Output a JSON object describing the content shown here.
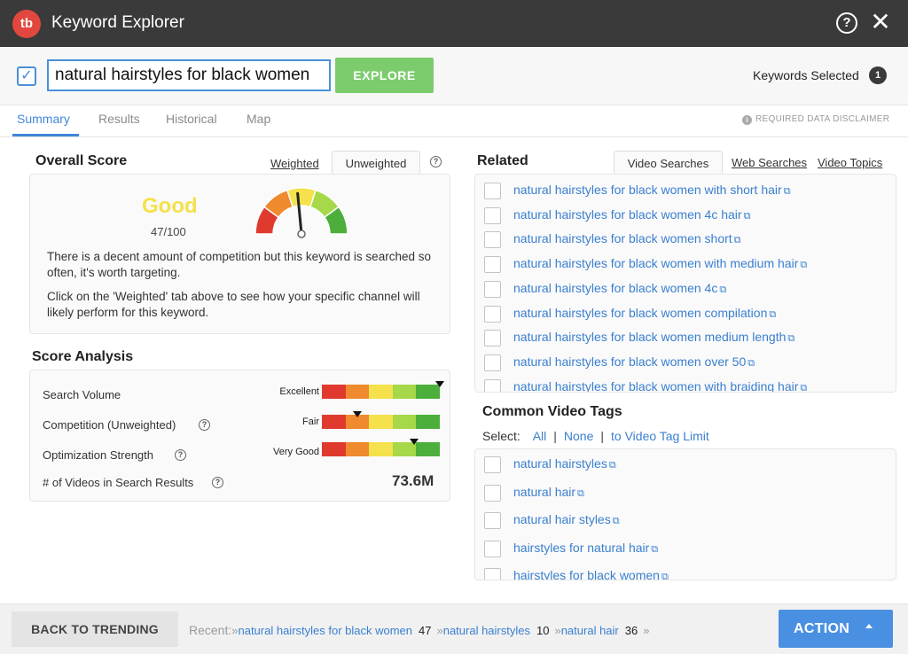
{
  "app": {
    "title": "Keyword Explorer",
    "logo_text": "tb"
  },
  "search": {
    "value": "natural hairstyles for black women",
    "explore_label": "EXPLORE",
    "keywords_selected_label": "Keywords Selected",
    "keywords_selected_count": "1"
  },
  "tabs": [
    {
      "label": "Summary",
      "active": true
    },
    {
      "label": "Results",
      "active": false
    },
    {
      "label": "Historical",
      "active": false
    },
    {
      "label": "Map",
      "active": false
    }
  ],
  "disclaimer": "REQUIRED DATA DISCLAIMER",
  "overall": {
    "heading": "Overall Score",
    "tab_weighted": "Weighted",
    "tab_unweighted": "Unweighted",
    "rating": "Good",
    "score": "47/100",
    "score_value": 47,
    "desc1": "There is a decent amount of competition but this keyword is searched so often, it's worth targeting.",
    "desc2": "Click on the 'Weighted' tab above to see how your specific channel will likely perform for this keyword."
  },
  "analysis": {
    "heading": "Score Analysis",
    "rows": [
      {
        "label": "Search Volume",
        "rating": "Excellent",
        "level": 1.0
      },
      {
        "label": "Competition (Unweighted)",
        "rating": "Fair",
        "level": 0.3
      },
      {
        "label": "Optimization Strength",
        "rating": "Very Good",
        "level": 0.78
      },
      {
        "label": "# of Videos in Search Results",
        "value": "73.6M"
      }
    ]
  },
  "related": {
    "heading": "Related",
    "tab_video_searches": "Video Searches",
    "tab_web_searches": "Web Searches",
    "tab_video_topics": "Video Topics",
    "items": [
      "natural hairstyles for black women with short hair",
      "natural hairstyles for black women 4c hair",
      "natural hairstyles for black women short",
      "natural hairstyles for black women with medium hair",
      "natural hairstyles for black women 4c",
      "natural hairstyles for black women compilation",
      "natural hairstyles for black women medium length",
      "natural hairstyles for black women over 50",
      "natural hairstyles for black women with braiding hair"
    ]
  },
  "tags": {
    "heading": "Common Video Tags",
    "select_label": "Select:",
    "all": "All",
    "none": "None",
    "limit": "to Video Tag Limit",
    "items": [
      "natural hairstyles",
      "natural hair",
      "natural hair styles",
      "hairstyles for natural hair",
      "hairstyles for black women"
    ]
  },
  "footer": {
    "back_label": "BACK TO TRENDING",
    "recent_label": "Recent:",
    "recent": [
      {
        "keyword": "natural hairstyles for black women",
        "score": "47"
      },
      {
        "keyword": "natural hairstyles",
        "score": "10"
      },
      {
        "keyword": "natural hair",
        "score": "36"
      }
    ],
    "action_label": "ACTION"
  },
  "colors": {
    "accent": "#3f87da",
    "explore": "#7ccc6d",
    "good": "#f4e14c",
    "scale": [
      "#e03a2f",
      "#ef8a2e",
      "#f4e14c",
      "#a6d84a",
      "#4caf3c"
    ]
  }
}
